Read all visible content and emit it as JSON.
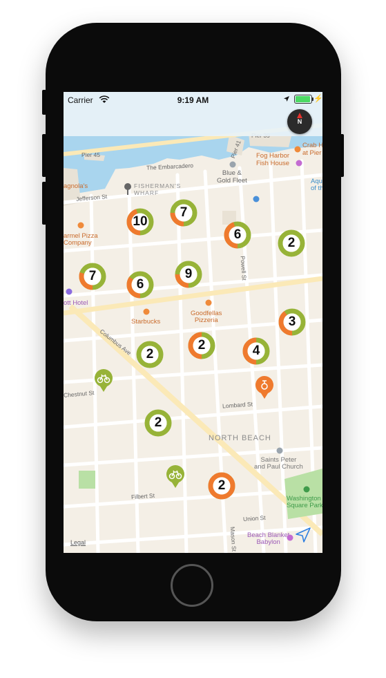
{
  "status_bar": {
    "carrier": "Carrier",
    "time": "9:19 AM",
    "battery_level": 1.0,
    "battery_color": "#4cd964"
  },
  "compass": {
    "label": "N",
    "needle_color": "#e5322d"
  },
  "colors": {
    "cluster_green": "#97b338",
    "cluster_orange": "#ef7a2e",
    "water": "#a9d5ee"
  },
  "map": {
    "district_labels": {
      "fishermans_wharf": "FISHERMAN'S\nWHARF",
      "north_beach": "NORTH BEACH"
    },
    "streets": {
      "pier45": "Pier 45",
      "embarcadero": "The Embarcadero",
      "jefferson": "Jefferson St",
      "powell": "Powell St",
      "columbus": "Columbus Ave",
      "chestnut": "Chestnut St",
      "lombard": "Lombard St",
      "filbert": "Filbert St",
      "union": "Union St",
      "mason": "Mason St",
      "pier39": "Pier 39",
      "pier41": "Pier 41"
    },
    "pois": {
      "blue_gold": "Blue &\nGold Fleet",
      "fog_harbor": "Fog Harbor\nFish House",
      "crab_house": "Crab H\nat Pier",
      "aquarium": "Aqu\nof th",
      "magnolias": "agnola's",
      "carmel_pizza": "armel Pizza\nCompany",
      "hotel": "ott Hotel",
      "starbucks": "Starbucks",
      "goodfellas": "Goodfellas\nPizzeria",
      "saints": "Saints Peter\nand Paul Church",
      "washington_sq": "Washington\nSquare Park",
      "beach_blanket": "Beach Blanket\nBabylon"
    },
    "legal": "Legal"
  },
  "clusters": [
    {
      "count": "10",
      "fraction_orange": 0.45
    },
    {
      "count": "7",
      "fraction_orange": 0.25
    },
    {
      "count": "6",
      "fraction_orange": 0.45
    },
    {
      "count": "2",
      "fraction_orange": 0.0
    },
    {
      "count": "7",
      "fraction_orange": 0.3
    },
    {
      "count": "6",
      "fraction_orange": 0.35
    },
    {
      "count": "9",
      "fraction_orange": 0.25
    },
    {
      "count": "3",
      "fraction_orange": 0.4
    },
    {
      "count": "2",
      "fraction_orange": 0.0
    },
    {
      "count": "2",
      "fraction_orange": 0.5
    },
    {
      "count": "4",
      "fraction_orange": 0.5
    },
    {
      "count": "2",
      "fraction_orange": 0.0
    },
    {
      "count": "2",
      "fraction_orange": 1.0
    }
  ],
  "bike_pins": [
    {
      "kind": "bike-icon",
      "color": "#97b338"
    },
    {
      "kind": "bike-icon",
      "color": "#97b338"
    },
    {
      "kind": "scooter-icon",
      "color": "#ef7a2e"
    }
  ]
}
